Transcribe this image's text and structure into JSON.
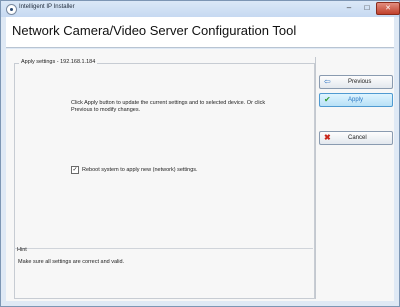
{
  "window": {
    "title": "Intelligent IP Installer",
    "minimize": "–",
    "maximize": "□",
    "close": "✕"
  },
  "header": {
    "title": "Network Camera/Video Server Configuration Tool"
  },
  "apply_settings": {
    "legend": "Apply settings - 192.168.1.184",
    "info": "Click Apply button to update the current settings and to selected device. Or click Previous to modify changes.",
    "reboot": {
      "checked": true,
      "label": "Reboot system to apply  new (network) settings."
    }
  },
  "hint": {
    "legend": "Hint",
    "text": "Make sure all settings are correct and valid."
  },
  "buttons": {
    "previous": "Previous",
    "apply": "Apply",
    "cancel": "Cancel"
  },
  "icons": {
    "previous": "left-arrow-icon",
    "apply": "checkmark-icon",
    "cancel": "red-x-icon"
  }
}
